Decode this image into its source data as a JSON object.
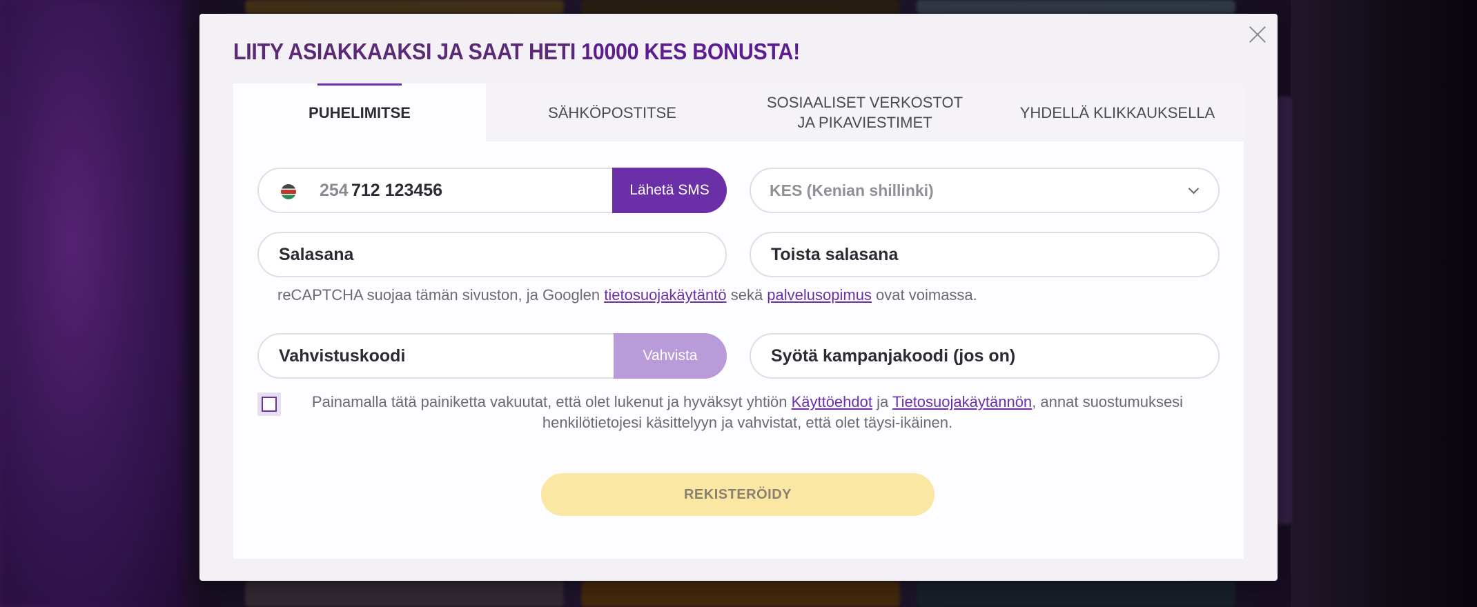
{
  "title": {
    "main": "LIITY ASIAKKAAKSI JA SAAT HETI ",
    "accent": "10000 KES BONUSTA!"
  },
  "tabs": [
    {
      "label": "PUHELIMITSE",
      "active": true
    },
    {
      "label": "SÄHKÖPOSTITSE",
      "active": false
    },
    {
      "label": "SOSIAALISET VERKOSTOT JA PIKAVIESTIMET",
      "active": false
    },
    {
      "label": "YHDELLÄ KLIKKAUKSELLA",
      "active": false
    }
  ],
  "phone": {
    "country_icon": "kenya-flag-icon",
    "prefix": "254",
    "number": "712 123456",
    "send_button": "Lähetä SMS"
  },
  "currency": {
    "value": "KES (Kenian shillinki)",
    "icon": "chevron-down-icon"
  },
  "password": {
    "placeholder": "Salasana"
  },
  "repeat_password": {
    "placeholder": "Toista salasana"
  },
  "recaptcha": {
    "text_before": "reCAPTCHA suojaa tämän sivuston, ja Googlen ",
    "privacy_link": "tietosuojakäytäntö",
    "text_middle": " sekä ",
    "terms_link": "palvelusopimus",
    "text_after": " ovat voimassa."
  },
  "verification": {
    "placeholder": "Vahvistuskoodi",
    "button": "Vahvista"
  },
  "promo": {
    "placeholder": "Syötä kampanjakoodi (jos on)"
  },
  "terms": {
    "text_before": "Painamalla tätä painiketta vakuutat, että olet lukenut ja hyväksyt yhtiön ",
    "terms_link": "Käyttöehdot",
    "text_middle": " ja ",
    "privacy_link": "Tietosuojakäytännön",
    "text_after": ", annat suostumuksesi henkilötietojesi käsittelyyn ja vahvistat, että olet täysi-ikäinen."
  },
  "register_button": "REKISTERÖIDY",
  "colors": {
    "accent_purple": "#6b2fa8",
    "title_purple": "#5b1d8f",
    "register_yellow": "#fae7a3"
  }
}
